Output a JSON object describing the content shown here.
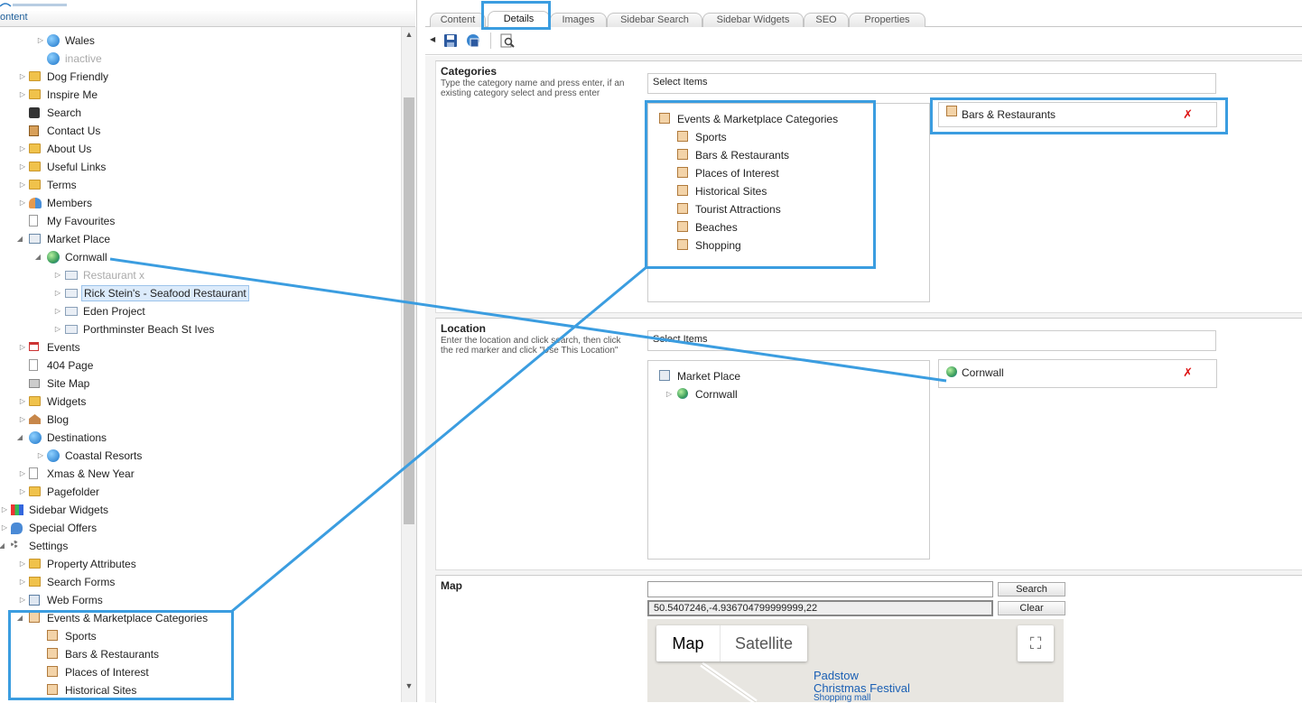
{
  "tree": {
    "header": "ontent",
    "rows": [
      {
        "label": "Wales",
        "icon": "globe-icon"
      },
      {
        "label": "inactive",
        "icon": "globe-icon"
      },
      {
        "label": "Dog Friendly",
        "icon": "folder-icon"
      },
      {
        "label": "Inspire Me",
        "icon": "folder-icon"
      },
      {
        "label": "Search",
        "icon": "binoculars-icon"
      },
      {
        "label": "Contact Us",
        "icon": "contact-icon"
      },
      {
        "label": "About Us",
        "icon": "folder-icon"
      },
      {
        "label": "Useful Links",
        "icon": "folder-icon"
      },
      {
        "label": "Terms",
        "icon": "folder-icon"
      },
      {
        "label": "Members",
        "icon": "members-icon"
      },
      {
        "label": "My Favourites",
        "icon": "page-icon"
      },
      {
        "label": "Market Place",
        "icon": "market-icon"
      },
      {
        "label": "Cornwall",
        "icon": "globe-green-icon"
      },
      {
        "label": "Restaurant x",
        "icon": "document-icon"
      },
      {
        "label": "Rick Stein's - Seafood Restaurant",
        "icon": "document-icon"
      },
      {
        "label": "Eden Project",
        "icon": "document-icon"
      },
      {
        "label": "Porthminster Beach St Ives",
        "icon": "document-icon"
      },
      {
        "label": "Events",
        "icon": "calendar-icon"
      },
      {
        "label": "404 Page",
        "icon": "page-icon"
      },
      {
        "label": "Site Map",
        "icon": "sitemap-icon"
      },
      {
        "label": "Widgets",
        "icon": "folder-icon"
      },
      {
        "label": "Blog",
        "icon": "home-icon"
      },
      {
        "label": "Destinations",
        "icon": "globe-icon"
      },
      {
        "label": "Coastal Resorts",
        "icon": "globe-icon"
      },
      {
        "label": "Xmas & New Year",
        "icon": "page-icon"
      },
      {
        "label": "Pagefolder",
        "icon": "folder-icon"
      },
      {
        "label": "Sidebar Widgets",
        "icon": "widgets-icon"
      },
      {
        "label": "Special Offers",
        "icon": "offers-icon"
      },
      {
        "label": "Settings",
        "icon": "gear-icon"
      },
      {
        "label": "Property Attributes",
        "icon": "folder-icon"
      },
      {
        "label": "Search Forms",
        "icon": "forms-icon"
      },
      {
        "label": "Web Forms",
        "icon": "webforms-icon"
      },
      {
        "label": "Events & Marketplace Categories",
        "icon": "category-icon"
      },
      {
        "label": "Sports",
        "icon": "category-icon"
      },
      {
        "label": "Bars & Restaurants",
        "icon": "category-icon"
      },
      {
        "label": "Places of Interest",
        "icon": "category-icon"
      },
      {
        "label": "Historical Sites",
        "icon": "category-icon"
      }
    ]
  },
  "tabs": [
    "Content",
    "Details",
    "Images",
    "Sidebar Search",
    "Sidebar Widgets",
    "SEO",
    "Properties"
  ],
  "active_tab": "Details",
  "toolbar": {
    "save_icon": "save-icon",
    "save_publish_icon": "save-publish-icon",
    "preview_icon": "preview-icon"
  },
  "categories": {
    "title": "Categories",
    "description": "Type the category name and press enter, if an existing category select and press enter",
    "input_value": "Select Items",
    "picker_items": [
      "Events & Marketplace Categories",
      "Sports",
      "Bars & Restaurants",
      "Places of Interest",
      "Historical Sites",
      "Tourist Attractions",
      "Beaches",
      "Shopping"
    ],
    "selected": "Bars & Restaurants",
    "remove_glyph": "✗"
  },
  "location": {
    "title": "Location",
    "description": "Enter the location and click search, then click the red marker and click \"Use This Location\"",
    "input_value": "Select Items",
    "picker_items": [
      "Market Place",
      "Cornwall"
    ],
    "selected": "Cornwall",
    "remove_glyph": "✗"
  },
  "map": {
    "title": "Map",
    "search_value": "",
    "coords_value": "50.5407246,-4.936704799999999,22",
    "search_button": "Search",
    "clear_button": "Clear",
    "type_map": "Map",
    "type_satellite": "Satellite",
    "fullscreen_glyph": "⛶",
    "labels": [
      "Padstow",
      "Christmas Festival",
      "Shopping mall"
    ]
  },
  "colors": {
    "highlight": "#3b9de0",
    "accent": "#1f5f9a"
  }
}
